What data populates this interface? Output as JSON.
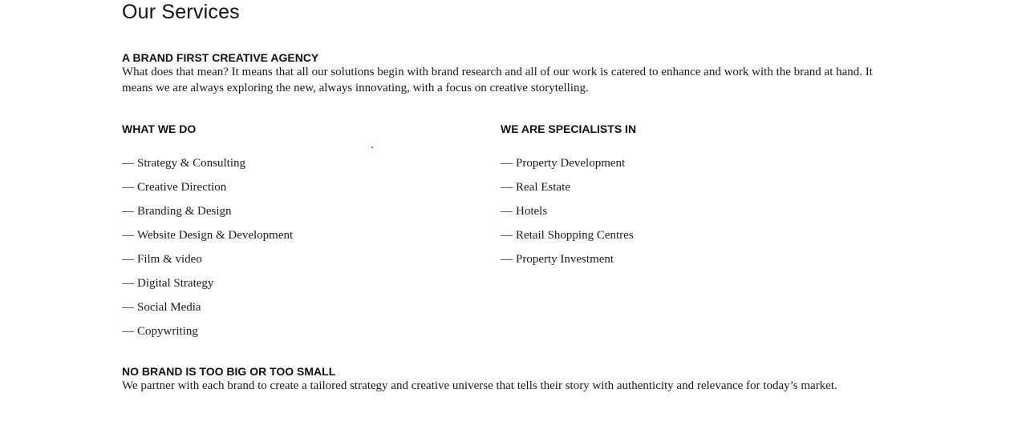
{
  "page": {
    "title": "Our Services"
  },
  "intro": {
    "heading": "A BRAND FIRST CREATIVE AGENCY",
    "body": "What does that mean? It means that all our solutions begin with brand research and all of our work is catered to enhance and work with the brand at hand. It means we are always exploring the new, always innovating, with a focus on creative storytelling."
  },
  "what_we_do": {
    "heading": "WHAT WE DO",
    "dash": "—",
    "items": [
      {
        "label": "Strategy & Consulting"
      },
      {
        "label": "Creative Direction"
      },
      {
        "label": "Branding & Design"
      },
      {
        "label": "Website Design & Development"
      },
      {
        "label": "Film & video"
      },
      {
        "label": "Digital Strategy"
      },
      {
        "label": "Social Media"
      },
      {
        "label": "Copywriting"
      }
    ]
  },
  "specialists": {
    "heading": "WE ARE SPECIALISTS IN",
    "dash": "—",
    "items": [
      {
        "label": "Property Development"
      },
      {
        "label": "Real Estate"
      },
      {
        "label": "Hotels"
      },
      {
        "label": "Retail Shopping Centres"
      },
      {
        "label": "Property Investment"
      }
    ]
  },
  "closing": {
    "heading": "NO BRAND IS TOO BIG OR TOO SMALL",
    "body": "We partner with each brand to create a tailored strategy and creative universe that tells their story with authenticity and relevance for today’s market."
  }
}
